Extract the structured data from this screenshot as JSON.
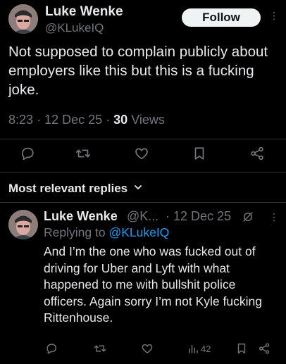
{
  "tweet": {
    "author_name": "Luke Wenke",
    "author_handle": "@KLukeIQ",
    "follow_label": "Follow",
    "text": "Not supposed to complain publicly about employers like this but this is a fucking joke.",
    "time": "8:23",
    "date": "12 Dec 25",
    "views_count": "30",
    "views_label": "Views",
    "separator": "·"
  },
  "section": {
    "title": "Most relevant replies",
    "chevron": "⌄"
  },
  "reply": {
    "author_name": "Luke Wenke",
    "author_handle_truncated": "@K...",
    "separator": "·",
    "date": "12 Dec 25",
    "replying_to_label": "Replying to",
    "replying_to_handle": "@KLukeIQ",
    "text": "And I’m the one who was fucked out of driving for Uber and Lyft with what happened to me with bullshit police officers.  Again sorry I’m not Kyle fucking Rittenhouse.",
    "views_count": "42"
  },
  "icons": [
    "reply-icon",
    "repost-icon",
    "like-icon",
    "bookmark-icon",
    "share-icon",
    "views-icon",
    "grok-icon",
    "more-icon"
  ],
  "colors": {
    "background": "#000000",
    "text": "#e7e9ea",
    "muted": "#71767b",
    "accent": "#1d9bf0",
    "divider": "#2f3336"
  }
}
